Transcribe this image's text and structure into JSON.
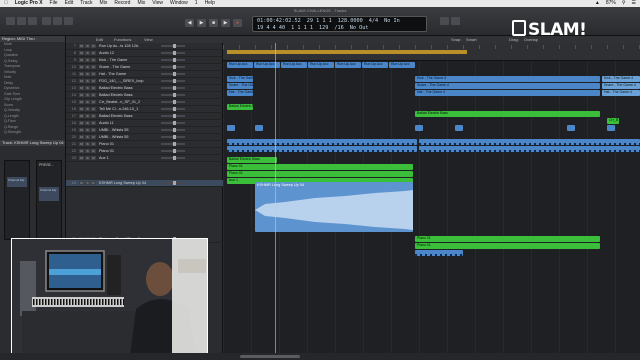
{
  "menubar": {
    "app": "Logic Pro X",
    "items": [
      "File",
      "Edit",
      "Track",
      "Mix",
      "Record",
      "Mix",
      "View",
      "Window",
      "1",
      "Help"
    ],
    "battery": "87%",
    "status_icons": [
      "wifi-icon",
      "bluetooth-icon",
      "volume-icon",
      "search-icon",
      "list-icon"
    ]
  },
  "window_title": "SLAM! CHALLENGE - Tracks",
  "lcd": {
    "time": "01:00:42:02.52",
    "bars": "19 4 4 40",
    "bars2": "29 1 1 1",
    "bars3": "1 1 1 1",
    "tempo": "128.0000",
    "tempo2": "129",
    "sig": "4/4",
    "sig2": "/16",
    "in": "No In",
    "out": "No Out"
  },
  "logo": "SLAM!",
  "inspector": {
    "region_header": "Region: MIDI Thru",
    "params": [
      "Mute",
      "Loop",
      "Quantize",
      "Q-Swing",
      "Transpose",
      "Velocity",
      "Note",
      "Delay",
      "Dynamics",
      "Gate Time",
      "Clip Length",
      "Score",
      "Q-Velocity",
      "Q-Length",
      "Q-Flam",
      "Q-Range",
      "Q-Strength"
    ],
    "quantize_value": "off",
    "track_header": "Track: KSHMR Long Sweep Up 04",
    "presets_label": "PRESE...",
    "channel_name": "Channel EQ",
    "channel_name_2": "Channel EQ"
  },
  "tracks_toolbar": {
    "edit": "Edit",
    "functions": "Functions",
    "view": "View",
    "snap_label": "Snap:",
    "snap_value": "Smart",
    "drag_label": "Drag:",
    "drag_value": "Overlap"
  },
  "tracks": [
    {
      "num": "7",
      "name": "Run Up Ac...ts 128 12A"
    },
    {
      "num": "8",
      "name": "Audio 12"
    },
    {
      "num": "9",
      "name": "Kick - The Game"
    },
    {
      "num": "10",
      "name": "Snare - The Game"
    },
    {
      "num": "11",
      "name": "Hat - The Game"
    },
    {
      "num": "12",
      "name": "FDG_140_..._SIREX_loop"
    },
    {
      "num": "13",
      "name": "Ballad Electric Bass"
    },
    {
      "num": "14",
      "name": "Ballad Electric Bass"
    },
    {
      "num": "15",
      "name": "Crr_Beatst...n_SP_01_2"
    },
    {
      "num": "16",
      "name": "Tell Me Cl...n-246-10_1"
    },
    {
      "num": "17",
      "name": "Ballad Electric Bass"
    },
    {
      "num": "18",
      "name": "Audio 11"
    },
    {
      "num": "19",
      "name": "UMBI - Whists 55"
    },
    {
      "num": "20",
      "name": "UMBI - Whists 55"
    },
    {
      "num": "21",
      "name": "Piano 01"
    },
    {
      "num": "22",
      "name": "Piano 01"
    },
    {
      "num": "23",
      "name": "Aux 1"
    },
    {
      "num": "24",
      "name": "KSHMR Long Sweep Up 04"
    },
    {
      "num": "25",
      "name": "Steinway Grand Piano 2"
    }
  ],
  "regions": {
    "run_up": "Run Up Acc",
    "kick": "Kick - The Game.4",
    "snare": "Snare - The Game.4",
    "hat": "Hat - The Game.4",
    "bass": "Ballad Electric Bass",
    "bass2": "Ballad Electric Bass",
    "piano": "Piano 01",
    "piano2": "Piano 01",
    "aux": "Aux 1",
    "sweep": "KSHMR Long Sweep Up 04",
    "kick_short": "Kick - The Game.2",
    "snare_short": "Snare - The Game.2",
    "hat_short": "Hat - The Game.2",
    "cm": "Crr_B",
    "piano_right": "Piano 01",
    "piano_right2": "Piano 01"
  },
  "colors": {
    "midi_blue": "#4a86c8",
    "audio_green": "#3bbf3b",
    "cycle_yellow": "#b8902a"
  }
}
